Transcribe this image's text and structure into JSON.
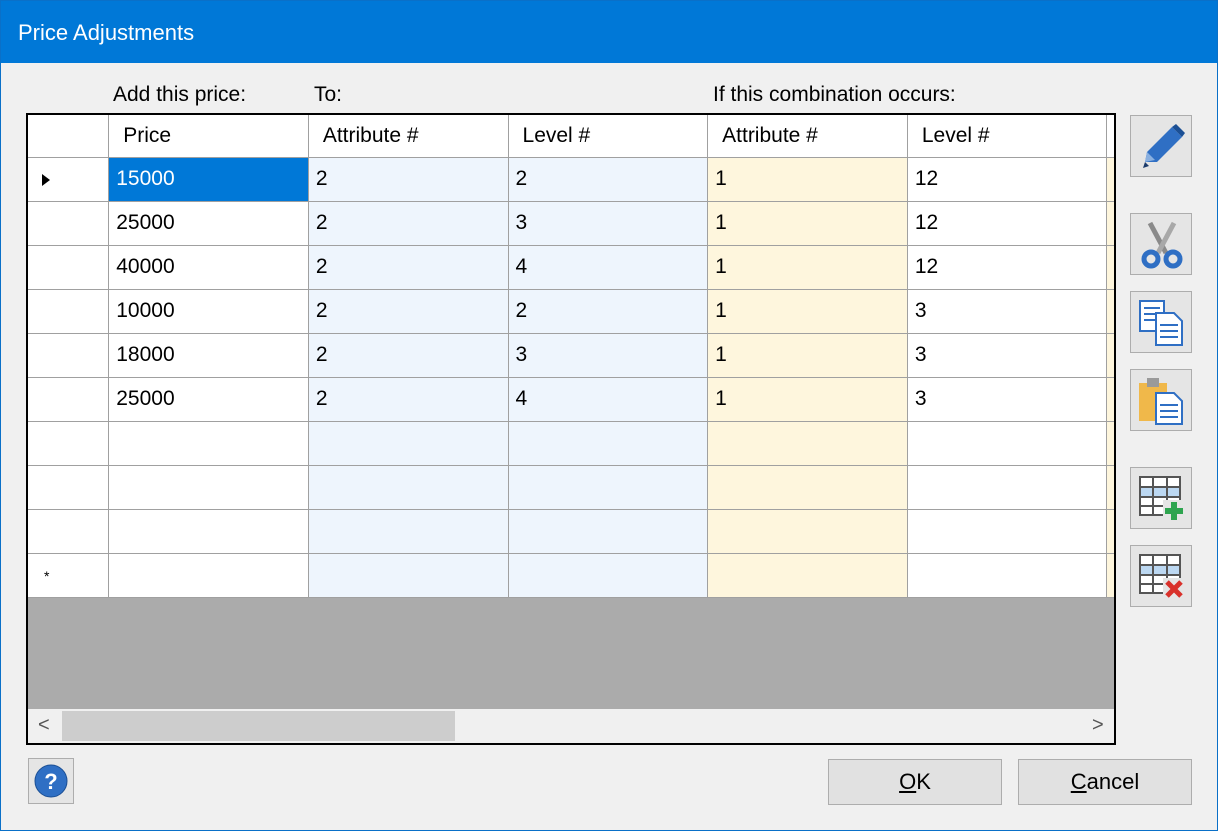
{
  "window": {
    "title": "Price Adjustments"
  },
  "labels": {
    "add_price": "Add this price:",
    "to": "To:",
    "combination": "If this combination occurs:"
  },
  "grid": {
    "columns": [
      "Price",
      "Attribute #",
      "Level #",
      "Attribute #",
      "Level #"
    ],
    "rows": [
      [
        "15000",
        "2",
        "2",
        "1",
        "12"
      ],
      [
        "25000",
        "2",
        "3",
        "1",
        "12"
      ],
      [
        "40000",
        "2",
        "4",
        "1",
        "12"
      ],
      [
        "10000",
        "2",
        "2",
        "1",
        "3"
      ],
      [
        "18000",
        "2",
        "3",
        "1",
        "3"
      ],
      [
        "25000",
        "2",
        "4",
        "1",
        "3"
      ],
      [
        "",
        "",
        "",
        "",
        ""
      ],
      [
        "",
        "",
        "",
        "",
        ""
      ],
      [
        "",
        "",
        "",
        "",
        ""
      ],
      [
        "",
        "",
        "",
        "",
        ""
      ]
    ],
    "current_row_marker": "▸",
    "new_row_marker": "*",
    "selected_cell": "15000"
  },
  "scrollbar": {
    "left_arrow": "<",
    "right_arrow": ">"
  },
  "toolbar": {
    "icons": [
      "pencil-icon",
      "scissors-icon",
      "copy-icon",
      "paste-icon",
      "add-row-icon",
      "delete-row-icon"
    ]
  },
  "buttons": {
    "ok_mnemonic": "O",
    "ok_rest": "K",
    "cancel_mnemonic": "C",
    "cancel_rest": "ancel",
    "help": "?"
  },
  "colors": {
    "titlebar": "#0078d7",
    "selection": "#0078d7",
    "to_columns": "#eef5fd",
    "combination_columns": "#fef6dd"
  }
}
